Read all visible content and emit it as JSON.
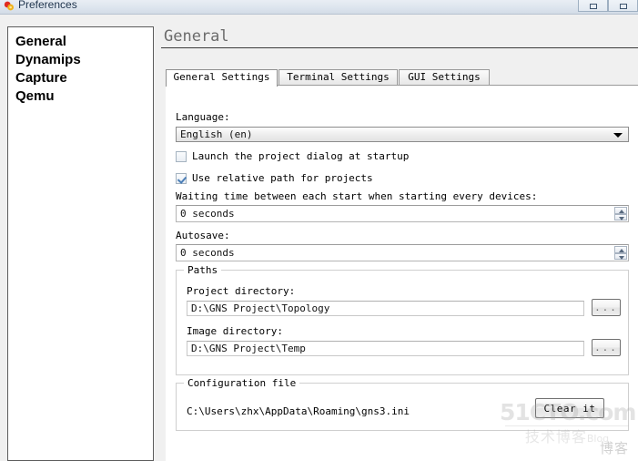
{
  "window": {
    "title": "Preferences",
    "icon": "app-icon",
    "buttons": [
      {
        "name": "restore-button",
        "label": ""
      },
      {
        "name": "close-button",
        "label": ""
      }
    ]
  },
  "sidebar": {
    "items": [
      {
        "label": "General"
      },
      {
        "label": "Dynamips"
      },
      {
        "label": "Capture"
      },
      {
        "label": "Qemu"
      }
    ]
  },
  "header": {
    "title": "General"
  },
  "tabs": [
    {
      "label": "General Settings",
      "active": true
    },
    {
      "label": "Terminal Settings",
      "active": false
    },
    {
      "label": "GUI Settings",
      "active": false
    }
  ],
  "general_settings": {
    "language_label": "Language:",
    "language_value": "English (en)",
    "launch_dialog": {
      "label": "Launch the project dialog at startup",
      "checked": false
    },
    "relative_path": {
      "label": "Use relative path for projects",
      "checked": true
    },
    "waiting_time_label": "Waiting time between each start when starting every devices:",
    "waiting_time_value": "0 seconds",
    "autosave_label": "Autosave:",
    "autosave_value": "0 seconds",
    "paths": {
      "group_title": "Paths",
      "project_dir_label": "Project directory:",
      "project_dir_value": "D:\\GNS Project\\Topology",
      "project_dir_browse": "...",
      "image_dir_label": "Image directory:",
      "image_dir_value": "D:\\GNS Project\\Temp",
      "image_dir_browse": "..."
    },
    "configuration": {
      "group_title": "Configuration file",
      "path": "C:\\Users\\zhx\\AppData\\Roaming\\gns3.ini",
      "clear_button": "Clear it"
    }
  },
  "watermark": {
    "main": "51CTO.com",
    "sub": "技术博客",
    "sub_small": "Blog",
    "ghost": "博客"
  }
}
